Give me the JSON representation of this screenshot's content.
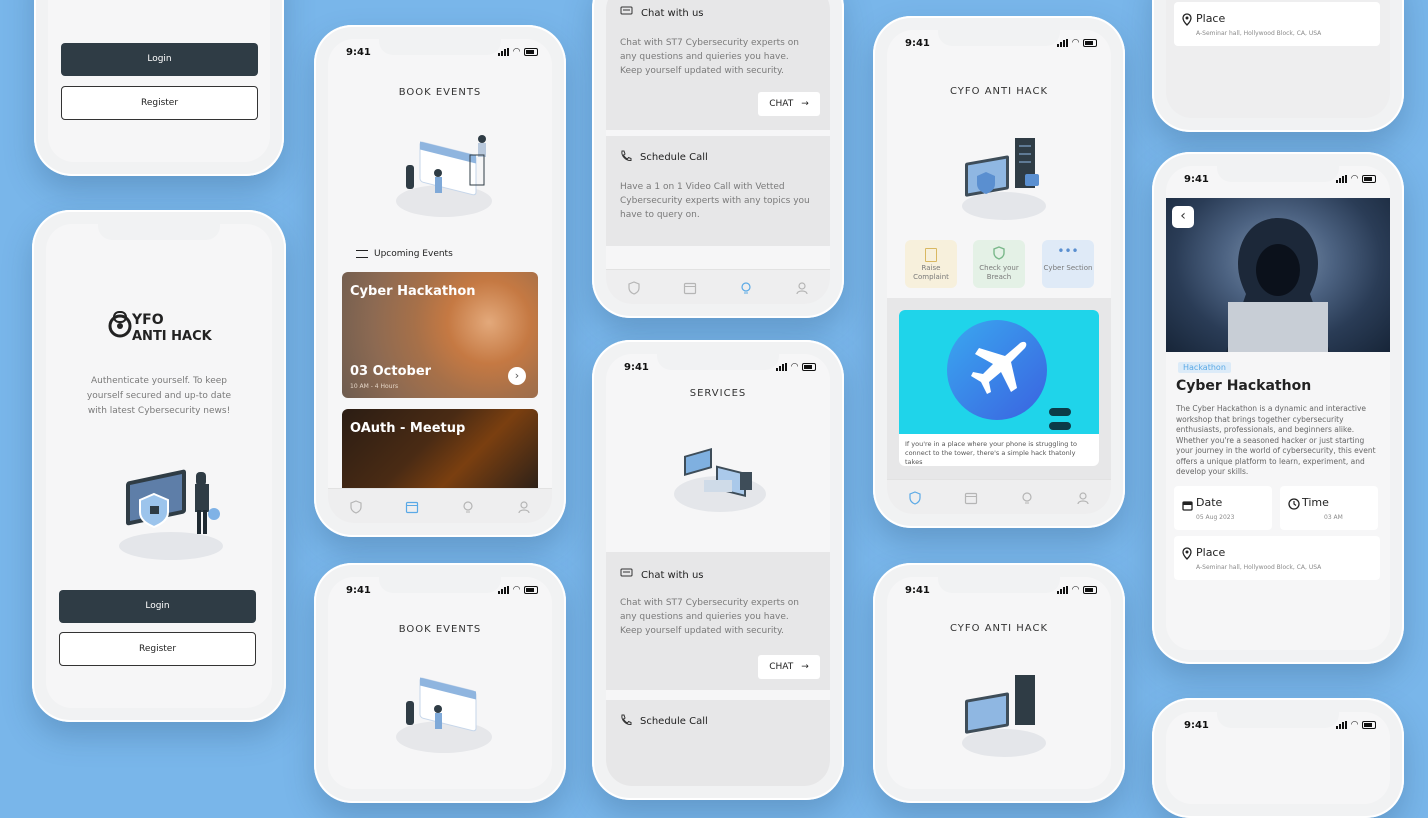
{
  "status_time": "9:41",
  "login": {
    "logo_text": "CYFO ANTI HACK",
    "tagline": "Authenticate yourself. To keep yourself secured and up-to date with latest Cybersecurity news!",
    "login_label": "Login",
    "register_label": "Register"
  },
  "book_events": {
    "title": "BOOK EVENTS",
    "section_label": "Upcoming Events",
    "events": [
      {
        "name": "Cyber Hackathon",
        "date": "03 October",
        "meta": "10 AM - 4 Hours"
      },
      {
        "name": "OAuth - Meetup"
      }
    ]
  },
  "services": {
    "title": "SERVICES",
    "chat_heading": "Chat with us",
    "chat_text": "Chat with ST7 Cybersecurity experts on any questions and quieries you have. Keep yourself updated with security.",
    "chat_button": "CHAT",
    "call_heading": "Schedule Call",
    "call_text": "Have a 1 on 1 Video Call with Vetted Cybersecurity experts with any topics you have to query on."
  },
  "home": {
    "title": "CYFO ANTI HACK",
    "tiles": [
      {
        "label": "Raise Complaint",
        "color": "#f7f0dc",
        "icon_color": "#d9b862"
      },
      {
        "label": "Check your Breach",
        "color": "#e4f1e6",
        "icon_color": "#7ab88a"
      },
      {
        "label": "Cyber Section",
        "color": "#dfeaf7",
        "icon_color": "#5a8fd0"
      }
    ],
    "tip_text": "If you're in a place where your phone is struggling to connect to the tower, there's a simple hack thatonly takes"
  },
  "event_detail": {
    "tag": "Hackathon",
    "title": "Cyber Hackathon",
    "description": "The Cyber Hackathon is a dynamic and interactive workshop that brings together cybersecurity enthusiasts, professionals, and beginners alike. Whether you're a seasoned hacker or just starting your journey in the world of cybersecurity, this event offers a unique platform to learn, experiment, and develop your skills.",
    "date_label": "Date",
    "date_value": "05 Aug 2023",
    "time_label": "Time",
    "time_value": "03 AM",
    "place_label": "Place",
    "place_value": "A-Seminar hall, Hollywood Block, CA, USA"
  },
  "colors": {
    "background": "#79b6ea",
    "dark_button": "#2f3c45",
    "accent_blue": "#5aa9e6"
  }
}
